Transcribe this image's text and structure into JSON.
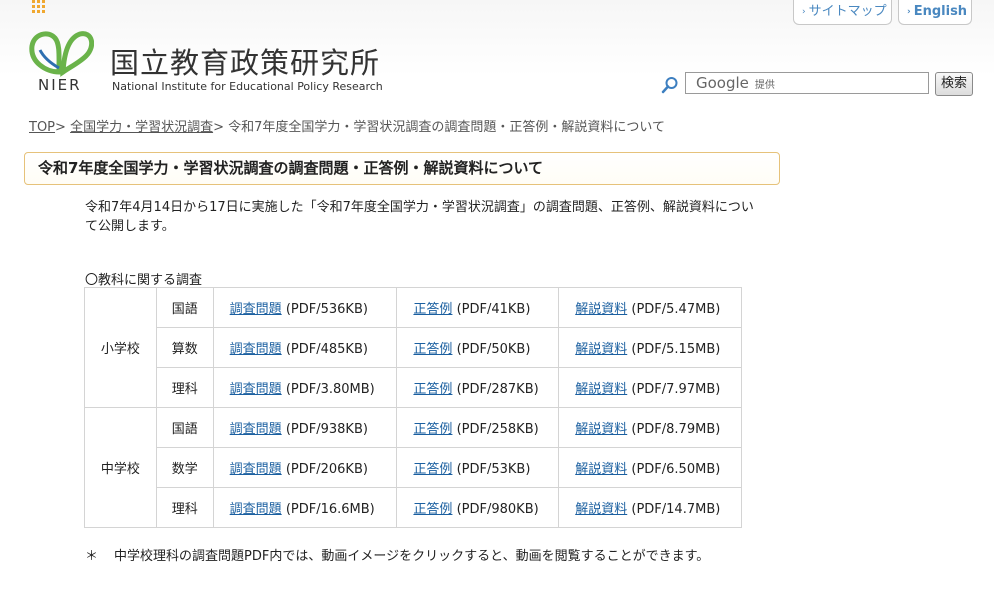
{
  "header": {
    "logo_text": "NIER",
    "org_name_ja": "国立教育政策研究所",
    "org_name_en": "National Institute for Educational Policy Research",
    "sitemap_label": "サイトマップ",
    "english_label": "English",
    "search": {
      "placeholder_google": "Google",
      "placeholder_provided": "提供",
      "button_label": "検索"
    }
  },
  "breadcrumb": {
    "top": "TOP",
    "sep": ">",
    "level1": "全国学力・学習状況調査",
    "current": "令和7年度全国学力・学習状況調査の調査問題・正答例・解説資料について"
  },
  "page": {
    "title": "令和7年度全国学力・学習状況調査の調査問題・正答例・解説資料について",
    "intro": "令和7年4月14日から17日に実施した「令和7年度全国学力・学習状況調査」の調査問題、正答例、解説資料について公開します。",
    "section_label": "〇教科に関する調査",
    "note_star": "＊",
    "note": "中学校理科の調査問題PDF内では、動画イメージをクリックすると、動画を閲覧することができます。"
  },
  "table": {
    "link_labels": {
      "problem": "調査問題",
      "answer": "正答例",
      "explanation": "解説資料"
    },
    "schools": [
      {
        "name": "小学校",
        "rows": [
          {
            "subject": "国語",
            "problem": "(PDF/536KB)",
            "answer": "(PDF/41KB)",
            "explanation": "(PDF/5.47MB)"
          },
          {
            "subject": "算数",
            "problem": "(PDF/485KB)",
            "answer": "(PDF/50KB)",
            "explanation": "(PDF/5.15MB)"
          },
          {
            "subject": "理科",
            "problem": "(PDF/3.80MB)",
            "answer": "(PDF/287KB)",
            "explanation": "(PDF/7.97MB)"
          }
        ]
      },
      {
        "name": "中学校",
        "rows": [
          {
            "subject": "国語",
            "problem": "(PDF/938KB)",
            "answer": "(PDF/258KB)",
            "explanation": "(PDF/8.79MB)"
          },
          {
            "subject": "数学",
            "problem": "(PDF/206KB)",
            "answer": "(PDF/53KB)",
            "explanation": "(PDF/6.50MB)"
          },
          {
            "subject": "理科",
            "problem": "(PDF/16.6MB)",
            "answer": "(PDF/980KB)",
            "explanation": "(PDF/14.7MB)"
          }
        ]
      }
    ]
  },
  "colors": {
    "link": "#1a5fa0",
    "title_border": "#e6c27a",
    "logo_green": "#6ab34a",
    "logo_blue": "#2e6fb0",
    "header_button_text": "#4a88c0"
  }
}
